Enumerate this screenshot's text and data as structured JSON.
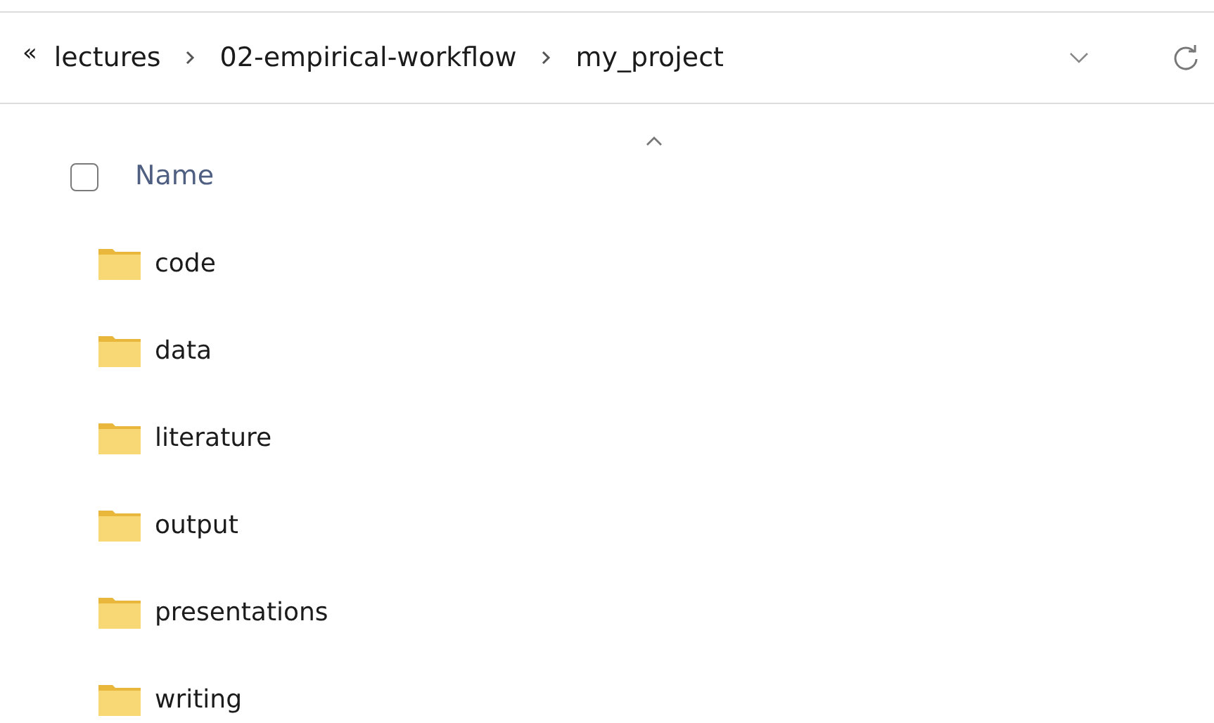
{
  "address_bar": {
    "overflow": "«",
    "path": [
      "lectures",
      "02-empirical-workflow",
      "my_project"
    ]
  },
  "header": {
    "select_all": {
      "checked": false
    },
    "column": "Name",
    "sorted_ascending": true
  },
  "items": [
    {
      "name": "code",
      "kind": "folder"
    },
    {
      "name": "data",
      "kind": "folder"
    },
    {
      "name": "literature",
      "kind": "folder"
    },
    {
      "name": "output",
      "kind": "folder"
    },
    {
      "name": "presentations",
      "kind": "folder"
    },
    {
      "name": "writing",
      "kind": "folder"
    }
  ]
}
